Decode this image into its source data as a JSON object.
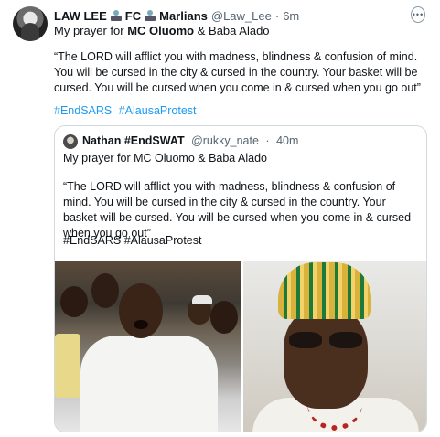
{
  "tweet": {
    "author_name": "LAW LEE",
    "author_suffix_1": "FC",
    "author_suffix_2": "Marlians",
    "handle": "@Law_Lee",
    "dot": "·",
    "time": "6m",
    "intro_prefix": "My prayer for ",
    "intro_bold": "MC Oluomo",
    "intro_suffix": " & Baba Alado",
    "body": "“The LORD will afflict you with madness, blindness & confusion of mind. You will be cursed in the city & cursed in the country. Your basket will be cursed. You will be cursed when you come in & cursed when you go out”",
    "hashtags": [
      "#EndSARS",
      "#AlausaProtest"
    ],
    "icons": {
      "emoji_1": "mountain-emoji-icon",
      "emoji_2": "mountain-emoji-icon",
      "more": "more-options-icon"
    }
  },
  "quote": {
    "author_name": "Nathan #EndSWAT",
    "handle": "@rukky_nate",
    "dot": "·",
    "time": "40m",
    "intro": "My prayer for MC Oluomo & Baba Alado",
    "body": "“The LORD will afflict you with madness, blindness & confusion of mind. You will be cursed in the city & cursed in the country. Your basket will be cursed. You will be cursed when you come in & cursed when you go out”",
    "hashtags": "#EndSARS #AlausaProtest"
  },
  "colors": {
    "link": "#1d9bf0",
    "secondary_text": "#536471",
    "border": "#cfd9de"
  }
}
